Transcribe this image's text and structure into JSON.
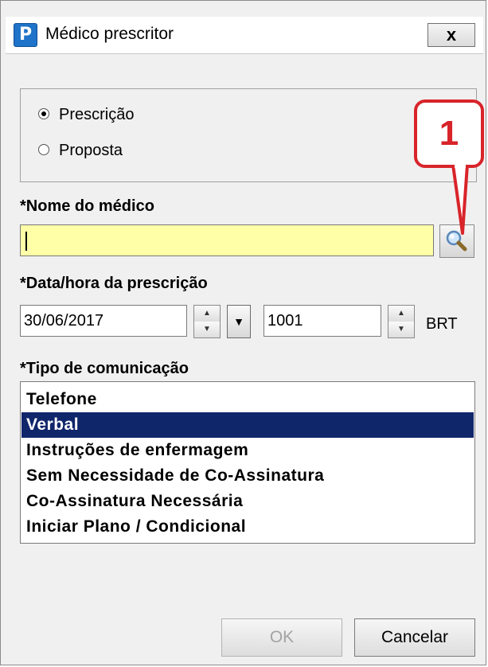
{
  "window": {
    "title": "Médico prescritor",
    "icon_letter": "P",
    "close_label": "x"
  },
  "order_type": {
    "options": [
      {
        "label": "Prescrição",
        "selected": true
      },
      {
        "label": "Proposta",
        "selected": false
      }
    ]
  },
  "callout": {
    "number": "1",
    "color": "#d8242a"
  },
  "physician": {
    "label": "*Nome do médico",
    "value": "",
    "field_color": "#ffffa8",
    "search_icon": "magnifier-icon"
  },
  "datetime": {
    "label": "*Data/hora da prescrição",
    "date": "30/06/2017",
    "time": "1001",
    "timezone": "BRT"
  },
  "communication": {
    "label": "*Tipo de comunicação",
    "items": [
      "Telefone",
      "Verbal",
      "Instruções de enfermagem",
      "Sem Necessidade de Co-Assinatura",
      "Co-Assinatura Necessária",
      "Iniciar Plano / Condicional"
    ],
    "selected": "Verbal",
    "selection_color": "#10266b"
  },
  "buttons": {
    "ok": "OK",
    "ok_enabled": false,
    "cancel": "Cancelar"
  }
}
